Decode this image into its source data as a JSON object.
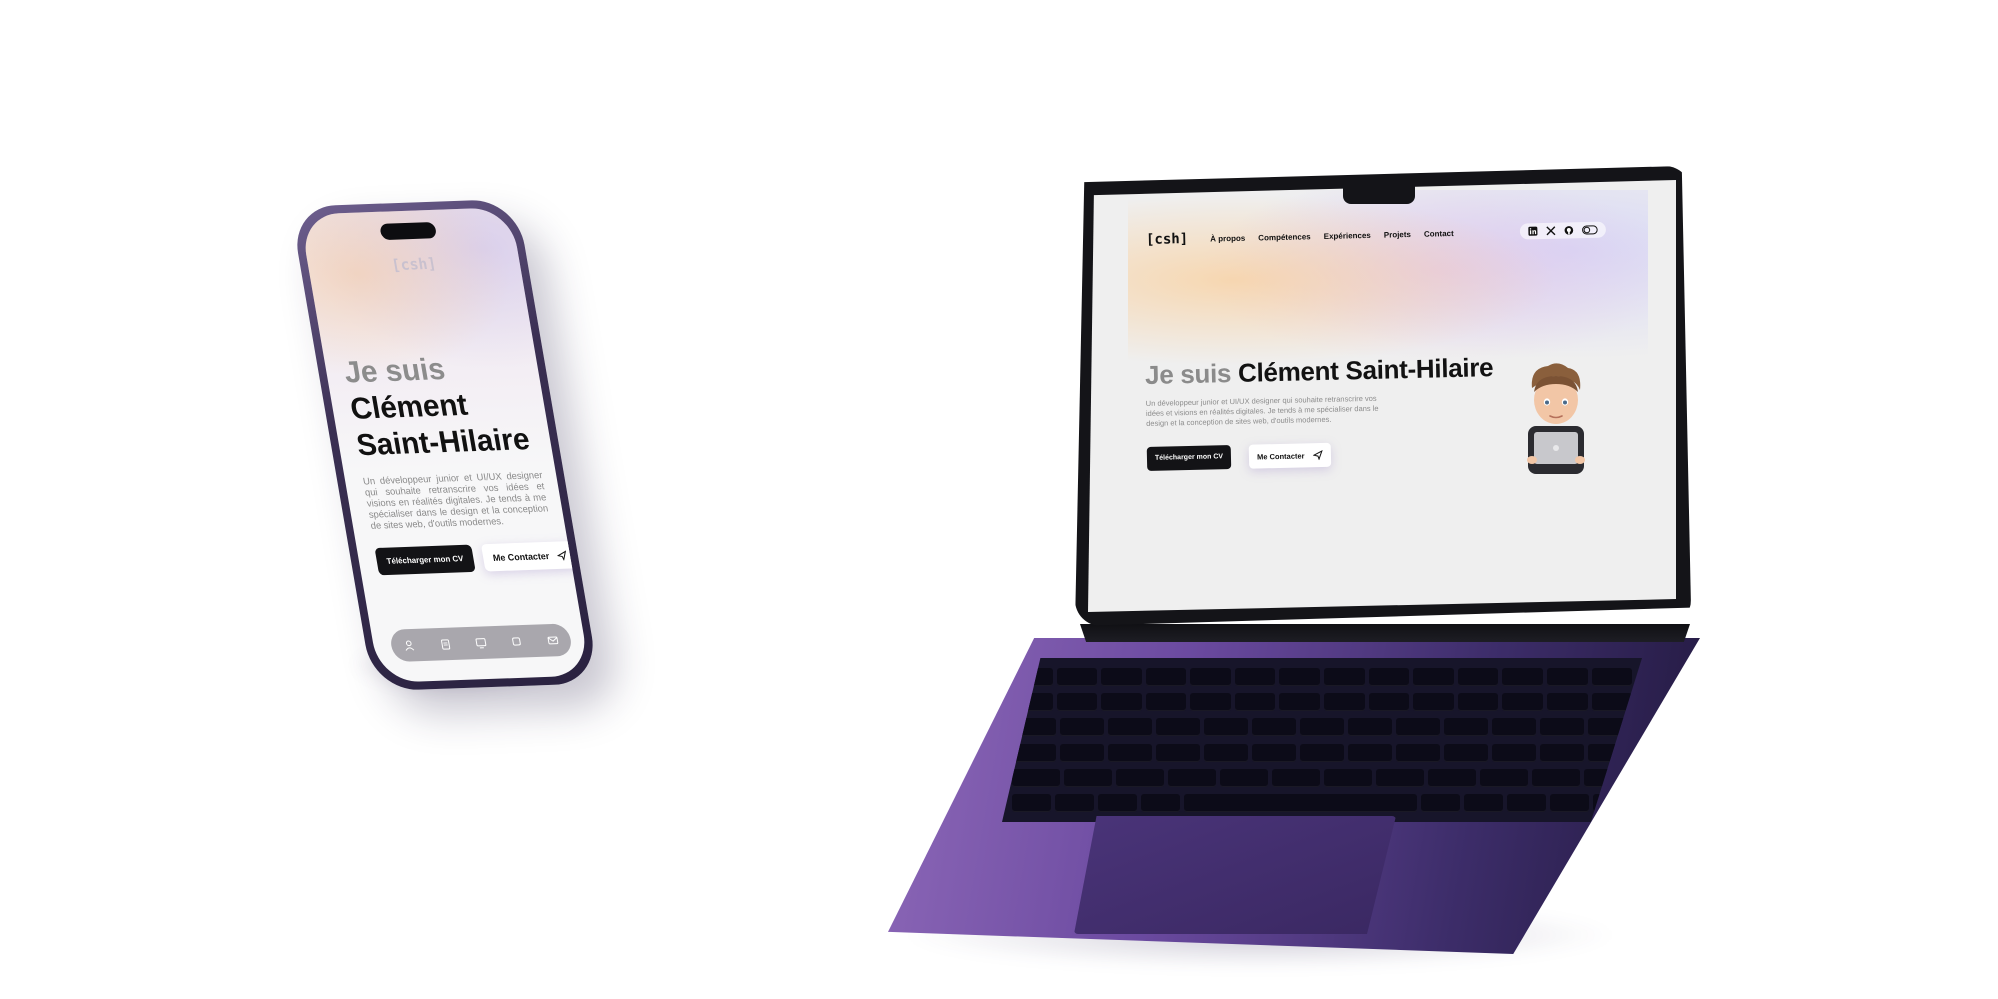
{
  "site": {
    "logo": "[csh]",
    "nav": [
      "À propos",
      "Compétences",
      "Expériences",
      "Projets",
      "Contact"
    ],
    "social_icons": [
      "linkedin-icon",
      "x-icon",
      "github-icon",
      "theme-toggle-icon"
    ],
    "hero_greeting": "Je suis",
    "hero_name": "Clément Saint-Hilaire",
    "hero_name_line1": "Clément",
    "hero_name_line2": "Saint-Hilaire",
    "hero_description": "Un développeur junior et UI/UX designer qui souhaite retranscrire vos idées et visions en réalités digitales. Je tends à me spécialiser dans le design et la conception de sites web, d'outils modernes.",
    "cta_primary": "Télécharger mon CV",
    "cta_secondary": "Me Contacter"
  },
  "phone": {
    "dock_icons": [
      "user-icon",
      "clipboard-icon",
      "projects-icon",
      "experience-icon",
      "mail-icon"
    ]
  },
  "colors": {
    "accent_dark": "#131316",
    "laptop_purple": "#6b4aa0",
    "title_grey": "#8b8b8b"
  }
}
